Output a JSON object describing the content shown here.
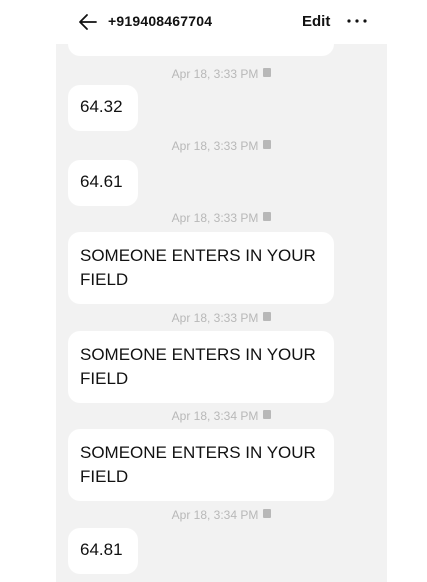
{
  "header": {
    "contact": "+919408467704",
    "edit_label": "Edit"
  },
  "messages": [
    {
      "timestamp": "Apr 18, 3:33 PM",
      "text": "64.32"
    },
    {
      "timestamp": "Apr 18, 3:33 PM",
      "text": "64.61"
    },
    {
      "timestamp": "Apr 18, 3:33 PM",
      "text": "SOMEONE ENTERS IN YOUR FIELD"
    },
    {
      "timestamp": "Apr 18, 3:33 PM",
      "text": "SOMEONE ENTERS IN YOUR FIELD"
    },
    {
      "timestamp": "Apr 18, 3:34 PM",
      "text": "SOMEONE ENTERS IN YOUR FIELD"
    },
    {
      "timestamp": "Apr 18, 3:34 PM",
      "text": "64.81"
    }
  ],
  "colors": {
    "chat_background": "#f2f2f2",
    "bubble": "#ffffff",
    "timestamp": "#b8b8b8"
  },
  "icons": [
    "back-arrow-icon",
    "more-icon",
    "sim-card-icon"
  ]
}
